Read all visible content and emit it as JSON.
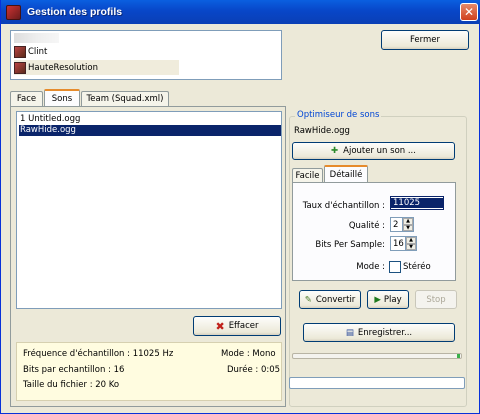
{
  "window": {
    "title": "Gestion des profils",
    "close_glyph": "✕"
  },
  "profiles": [
    {
      "name": "Clint"
    },
    {
      "name": "HauteResolution"
    }
  ],
  "buttons": {
    "close": "Fermer",
    "delete": "Effacer",
    "add_sound": "Ajouter un son ...",
    "convert": "Convertir",
    "play": "Play",
    "stop": "Stop",
    "save": "Enregistrer..."
  },
  "tabs": [
    {
      "label": "Face"
    },
    {
      "label": "Sons"
    },
    {
      "label": "Team (Squad.xml)"
    }
  ],
  "sounds": [
    {
      "name": "1 Untitled.ogg"
    },
    {
      "name": "RawHide.ogg"
    }
  ],
  "info": {
    "sample_rate": "Fréquence d'échantillon : 11025 Hz",
    "bits": "Bits par echantillon : 16",
    "file_size": "Taille du fichier : 20 Ko",
    "mode": "Mode : Mono",
    "duration": "Durée : 0:05"
  },
  "optimizer": {
    "legend": "Optimiseur de sons",
    "current_file": "RawHide.ogg",
    "tabs": [
      {
        "label": "Facile"
      },
      {
        "label": "Détaillé"
      }
    ],
    "labels": {
      "sample_rate": "Taux d'échantillon :",
      "quality": "Qualité :",
      "bits": "Bits Per Sample:",
      "mode": "Mode :",
      "stereo": "Stéréo"
    },
    "values": {
      "sample_rate": "11025",
      "quality": "2",
      "bits": "16"
    }
  },
  "progress": 0.02,
  "colors": {
    "title_bar": "#0846c8",
    "selection": "#0a246a",
    "tab_accent": "#e68b2c",
    "info_bg": "#fffce0"
  }
}
